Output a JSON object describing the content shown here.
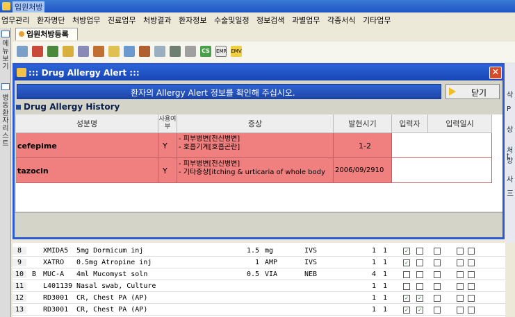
{
  "window": {
    "title": "입원처방"
  },
  "menu": [
    "업무관리",
    "환자명단",
    "처방업무",
    "진료업무",
    "처방결과",
    "환자정보",
    "수술및일정",
    "정보검색",
    "과별업무",
    "각종서식",
    "기타업무"
  ],
  "sidebar": {
    "tab1": "메뉴보기",
    "tab2": "병동환자리스트"
  },
  "doc_tab": {
    "label": "입원처방등록"
  },
  "toolbar": {
    "icons": [
      "print-icon",
      "chart-icon",
      "book-icon",
      "search-icon",
      "zoom-icon",
      "edit-icon",
      "note-icon",
      "form-icon",
      "user-icon",
      "pill-icon",
      "bed-icon",
      "list-icon",
      "cs-icon",
      "emr-icon",
      "emv-icon"
    ],
    "labels": [
      "CS",
      "EMR",
      "EMV"
    ]
  },
  "right_strip": [
    "삭",
    "P",
    "상",
    "처방",
    "t",
    "사",
    "三"
  ],
  "dialog": {
    "title": "::: Drug Allergy Alert :::",
    "message": "환자의 Allergy Alert 정보를 확인해 주십시오.",
    "close_label": "닫기",
    "section_title": "Drug Allergy History",
    "headers": {
      "ingredient": "성분명",
      "used": "사용여부",
      "symptom": "증상",
      "onset": "발현시기",
      "entered_by": "입력자",
      "entered_at": "입력일시"
    },
    "rows": [
      {
        "ingredient": "cefepime",
        "used": "Y",
        "symptom_1": "- 피부병변[전신병변]",
        "symptom_2": "- 호흡기계[호흡곤란]",
        "onset": "1-2",
        "entered_by": "",
        "entered_at": ""
      },
      {
        "ingredient": "tazocin",
        "used": "Y",
        "symptom_1": "- 피부병변[전신병변]",
        "symptom_2": "- 기타증상[itching & urticaria of whole body",
        "onset": "2006/09/2910",
        "entered_by": "",
        "entered_at": ""
      }
    ]
  },
  "orders": [
    {
      "no": "8",
      "flag": "",
      "code": "XMIDA5",
      "name": "5mg Dormicum inj",
      "qty": "1.5",
      "unit": "mg",
      "route": "IVS",
      "a": "1",
      "b": "1",
      "checks": [
        true,
        false,
        false,
        false,
        false
      ]
    },
    {
      "no": "9",
      "flag": "",
      "code": "XATRO",
      "name": "0.5mg Atropine inj",
      "qty": "1",
      "unit": "AMP",
      "route": "IVS",
      "a": "1",
      "b": "1",
      "checks": [
        true,
        false,
        false,
        false,
        false
      ]
    },
    {
      "no": "10",
      "flag": "B",
      "code": "MUC-A",
      "name": "4ml Mucomyst soln",
      "qty": "0.5",
      "unit": "VIA",
      "route": "NEB",
      "a": "4",
      "b": "1",
      "checks": [
        false,
        false,
        false,
        false,
        false
      ]
    },
    {
      "no": "11",
      "flag": "",
      "code": "L401139",
      "name": "Nasal swab, Culture",
      "qty": "",
      "unit": "",
      "route": "",
      "a": "1",
      "b": "1",
      "checks": [
        false,
        false,
        false,
        false,
        false
      ]
    },
    {
      "no": "12",
      "flag": "",
      "code": "RD3001",
      "name": "CR, Chest PA (AP)",
      "qty": "",
      "unit": "",
      "route": "",
      "a": "1",
      "b": "1",
      "checks": [
        true,
        true,
        false,
        false,
        false
      ]
    },
    {
      "no": "13",
      "flag": "",
      "code": "RD3001",
      "name": "CR, Chest PA (AP)",
      "qty": "",
      "unit": "",
      "route": "",
      "a": "1",
      "b": "1",
      "checks": [
        true,
        true,
        false,
        false,
        false
      ]
    }
  ]
}
